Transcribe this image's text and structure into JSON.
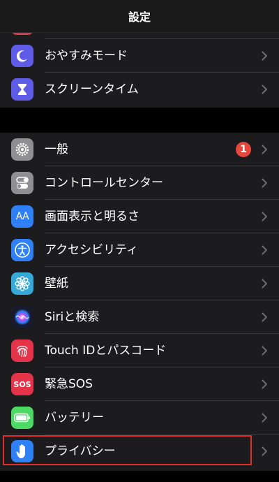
{
  "nav": {
    "title": "設定"
  },
  "colors": {
    "background": "#000000",
    "group_background": "#1c1c1e",
    "separator": "#3a3a3c",
    "highlight": "#e22b2b",
    "badge": "#e5473d"
  },
  "group1": {
    "items": [
      {
        "label": "おやすみモード",
        "icon": "moon-icon",
        "icon_color": "#5e5ce6"
      },
      {
        "label": "スクリーンタイム",
        "icon": "hourglass-icon",
        "icon_color": "#5e5ce6"
      }
    ]
  },
  "group2": {
    "items": [
      {
        "label": "一般",
        "icon": "gear-icon",
        "icon_color": "#8e8e93",
        "badge": "1"
      },
      {
        "label": "コントロールセンター",
        "icon": "toggles-icon",
        "icon_color": "#8e8e93"
      },
      {
        "label": "画面表示と明るさ",
        "icon": "text-size-icon",
        "icon_text": "AA",
        "icon_color": "#2f7ff5"
      },
      {
        "label": "アクセシビリティ",
        "icon": "accessibility-icon",
        "icon_color": "#2f7ff5"
      },
      {
        "label": "壁紙",
        "icon": "flower-icon",
        "icon_color": "#36a9d8"
      },
      {
        "label": "Siriと検索",
        "icon": "siri-icon",
        "icon_color": "#1a1a2e"
      },
      {
        "label": "Touch IDとパスコード",
        "icon": "fingerprint-icon",
        "icon_color": "#e5334a"
      },
      {
        "label": "緊急SOS",
        "icon": "sos-icon",
        "icon_text": "SOS",
        "icon_color": "#e5334a"
      },
      {
        "label": "バッテリー",
        "icon": "battery-icon",
        "icon_color": "#4cd964"
      },
      {
        "label": "プライバシー",
        "icon": "hand-icon",
        "icon_color": "#2f7ff5",
        "highlighted": true
      }
    ]
  }
}
